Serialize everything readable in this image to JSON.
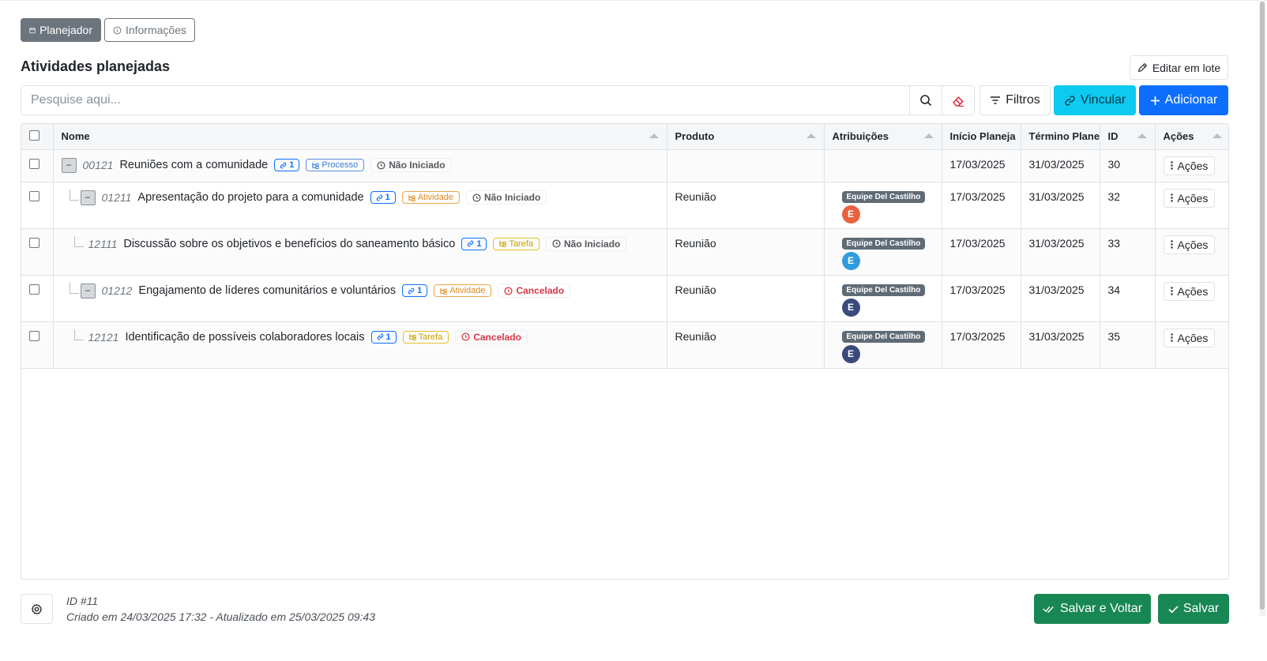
{
  "tabs": {
    "planner": "Planejador",
    "info": "Informações"
  },
  "page_title": "Atividades planejadas",
  "edit_batch": "Editar em lote",
  "search": {
    "placeholder": "Pesquise aqui..."
  },
  "buttons": {
    "filters": "Filtros",
    "link": "Vincular",
    "add": "Adicionar"
  },
  "columns": {
    "name": "Nome",
    "product": "Produto",
    "assignments": "Atribuições",
    "start": "Início Planeja",
    "end": "Término Plane",
    "id": "ID",
    "actions": "Ações"
  },
  "rows": [
    {
      "code": "00121",
      "name": "Reuniões com a comunidade",
      "links": "1",
      "type": "Processo",
      "status": "Não Iniciado",
      "product": "",
      "team": "",
      "avatar": "",
      "start": "17/03/2025",
      "end": "31/03/2025",
      "id": "30",
      "actions": "Ações"
    },
    {
      "code": "01211",
      "name": "Apresentação do projeto para a comunidade",
      "links": "1",
      "type": "Atividade",
      "status": "Não Iniciado",
      "product": "Reunião",
      "team": "Equipe Del Castilho",
      "avatar": "E",
      "start": "17/03/2025",
      "end": "31/03/2025",
      "id": "32",
      "actions": "Ações"
    },
    {
      "code": "12111",
      "name": "Discussão sobre os objetivos e benefícios do saneamento básico",
      "links": "1",
      "type": "Tarefa",
      "status": "Não Iniciado",
      "product": "Reunião",
      "team": "Equipe Del Castilho",
      "avatar": "E",
      "start": "17/03/2025",
      "end": "31/03/2025",
      "id": "33",
      "actions": "Ações"
    },
    {
      "code": "01212",
      "name": "Engajamento de líderes comunitários e voluntários",
      "links": "1",
      "type": "Atividade",
      "status": "Cancelado",
      "product": "Reunião",
      "team": "Equipe Del Castilho",
      "avatar": "E",
      "start": "17/03/2025",
      "end": "31/03/2025",
      "id": "34",
      "actions": "Ações"
    },
    {
      "code": "12121",
      "name": "Identificação de possíveis colaboradores locais",
      "links": "1",
      "type": "Tarefa",
      "status": "Cancelado",
      "product": "Reunião",
      "team": "Equipe Del Castilho",
      "avatar": "E",
      "start": "17/03/2025",
      "end": "31/03/2025",
      "id": "35",
      "actions": "Ações"
    }
  ],
  "avatar_colors": {
    "row2": "#e8623f",
    "row3": "#2f9be0",
    "row4": "#3b4a7d",
    "row5": "#3b4a7d"
  },
  "collapse_symbol": "−",
  "footer": {
    "record_id": "ID #11",
    "timestamps": "Criado em 24/03/2025 17:32 - Atualizado em 25/03/2025 09:43",
    "save_back": "Salvar e Voltar",
    "save": "Salvar"
  }
}
